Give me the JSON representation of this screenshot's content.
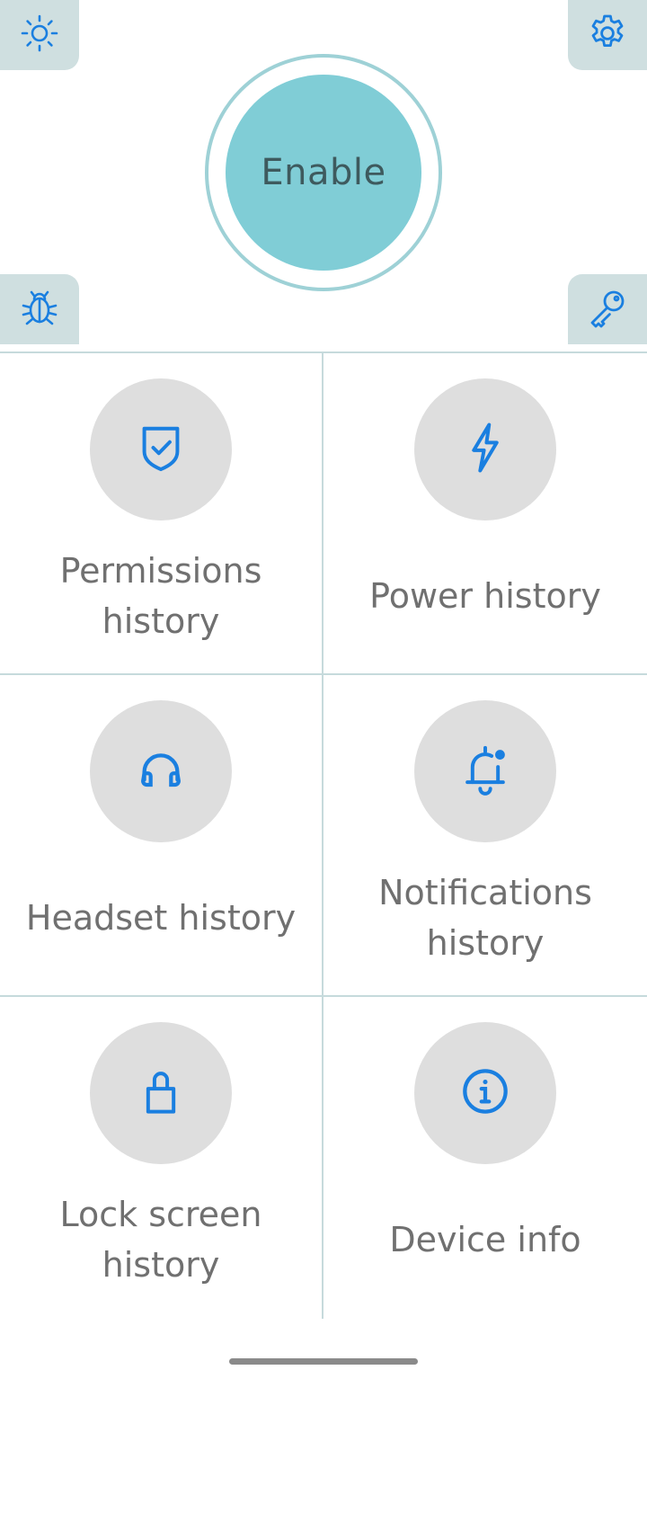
{
  "header": {
    "enable_label": "Enable",
    "corner_buttons": {
      "top_left_icon": "sun-icon",
      "top_right_icon": "gear-icon",
      "bottom_left_icon": "bug-icon",
      "bottom_right_icon": "key-icon"
    }
  },
  "colors": {
    "accent": "#80cdd6",
    "icon": "#1a7fe0",
    "tile": "#dedede",
    "corner": "#cfdfe0"
  },
  "tiles": [
    {
      "label": "Permissions history",
      "icon": "shield-check-icon"
    },
    {
      "label": "Power history",
      "icon": "lightning-icon"
    },
    {
      "label": "Headset history",
      "icon": "headset-icon"
    },
    {
      "label": "Notifications history",
      "icon": "bell-icon"
    },
    {
      "label": "Lock screen history",
      "icon": "lock-icon"
    },
    {
      "label": "Device info",
      "icon": "info-icon"
    }
  ]
}
